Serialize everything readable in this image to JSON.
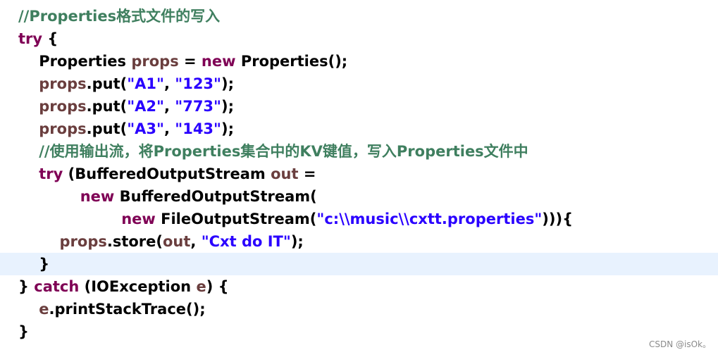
{
  "editor": {
    "lines": [
      [
        {
          "type": "comment",
          "text": "//Properties格式文件的写入"
        }
      ],
      [
        {
          "type": "keyword",
          "text": "try"
        },
        {
          "type": "plain",
          "text": " {"
        }
      ],
      [
        {
          "type": "plain",
          "text": "    Properties "
        },
        {
          "type": "var",
          "text": "props"
        },
        {
          "type": "plain",
          "text": " = "
        },
        {
          "type": "keyword",
          "text": "new"
        },
        {
          "type": "plain",
          "text": " Properties();"
        }
      ],
      [
        {
          "type": "plain",
          "text": "    "
        },
        {
          "type": "var",
          "text": "props"
        },
        {
          "type": "plain",
          "text": ".put("
        },
        {
          "type": "string",
          "text": "\"A1\""
        },
        {
          "type": "plain",
          "text": ", "
        },
        {
          "type": "string",
          "text": "\"123\""
        },
        {
          "type": "plain",
          "text": ");"
        }
      ],
      [
        {
          "type": "plain",
          "text": "    "
        },
        {
          "type": "var",
          "text": "props"
        },
        {
          "type": "plain",
          "text": ".put("
        },
        {
          "type": "string",
          "text": "\"A2\""
        },
        {
          "type": "plain",
          "text": ", "
        },
        {
          "type": "string",
          "text": "\"773\""
        },
        {
          "type": "plain",
          "text": ");"
        }
      ],
      [
        {
          "type": "plain",
          "text": "    "
        },
        {
          "type": "var",
          "text": "props"
        },
        {
          "type": "plain",
          "text": ".put("
        },
        {
          "type": "string",
          "text": "\"A3\""
        },
        {
          "type": "plain",
          "text": ", "
        },
        {
          "type": "string",
          "text": "\"143\""
        },
        {
          "type": "plain",
          "text": ");"
        }
      ],
      [
        {
          "type": "plain",
          "text": "    "
        },
        {
          "type": "comment",
          "text": "//使用输出流，将Properties集合中的KV键值，写入Properties文件中"
        }
      ],
      [
        {
          "type": "plain",
          "text": "    "
        },
        {
          "type": "keyword",
          "text": "try"
        },
        {
          "type": "plain",
          "text": " (BufferedOutputStream "
        },
        {
          "type": "var",
          "text": "out"
        },
        {
          "type": "plain",
          "text": " ="
        }
      ],
      [
        {
          "type": "plain",
          "text": "            "
        },
        {
          "type": "keyword",
          "text": "new"
        },
        {
          "type": "plain",
          "text": " BufferedOutputStream("
        }
      ],
      [
        {
          "type": "plain",
          "text": "                    "
        },
        {
          "type": "keyword",
          "text": "new"
        },
        {
          "type": "plain",
          "text": " FileOutputStream("
        },
        {
          "type": "string",
          "text": "\"c:\\\\music\\\\cxtt.properties\""
        },
        {
          "type": "plain",
          "text": "))){"
        }
      ],
      [
        {
          "type": "plain",
          "text": "        "
        },
        {
          "type": "var",
          "text": "props"
        },
        {
          "type": "plain",
          "text": ".store("
        },
        {
          "type": "var",
          "text": "out"
        },
        {
          "type": "plain",
          "text": ", "
        },
        {
          "type": "string",
          "text": "\"Cxt do IT\""
        },
        {
          "type": "plain",
          "text": ");"
        }
      ],
      [
        {
          "type": "plain",
          "text": "    }"
        }
      ],
      [
        {
          "type": "plain",
          "text": "} "
        },
        {
          "type": "keyword",
          "text": "catch"
        },
        {
          "type": "plain",
          "text": " (IOException "
        },
        {
          "type": "var",
          "text": "e"
        },
        {
          "type": "plain",
          "text": ") {"
        }
      ],
      [
        {
          "type": "plain",
          "text": "    "
        },
        {
          "type": "var",
          "text": "e"
        },
        {
          "type": "plain",
          "text": ".printStackTrace();"
        }
      ],
      [
        {
          "type": "plain",
          "text": "}"
        }
      ]
    ],
    "current_line_index": 11
  },
  "watermark": {
    "text": "CSDN @isOk。"
  },
  "colors": {
    "comment": "#3f7f5f",
    "keyword": "#7f0055",
    "string": "#2a00ff",
    "variable": "#6a3e3e",
    "plain": "#000000",
    "current_line": "#e8f2fe"
  }
}
